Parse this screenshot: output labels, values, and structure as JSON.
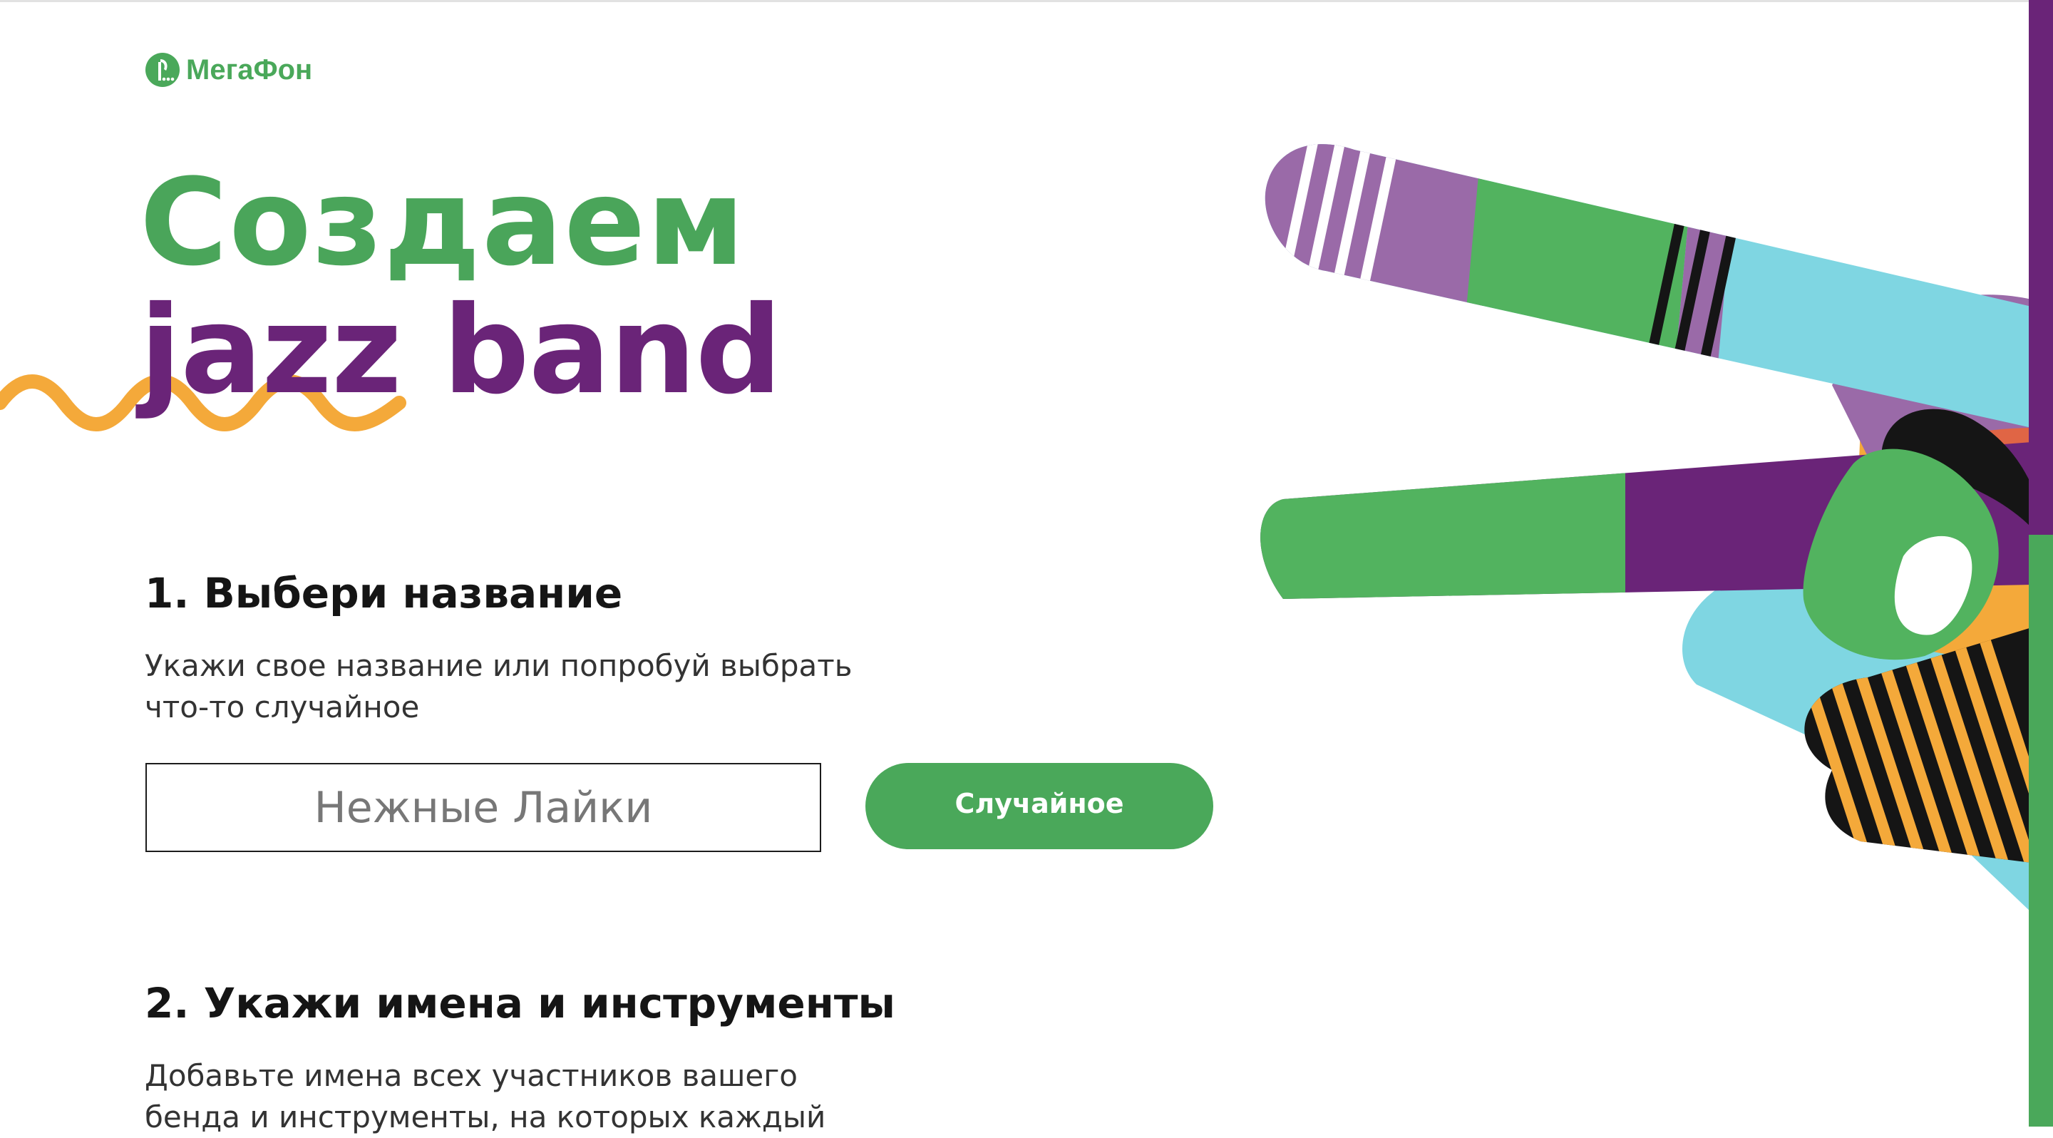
{
  "brand": {
    "name": "МегаФон",
    "colors": {
      "green": "#4aa85a",
      "purple": "#6a2478",
      "orange": "#f4a93a",
      "light_blue": "#7fd6e2",
      "lavender": "#9a6aa8"
    }
  },
  "hero": {
    "line1": "Создаем",
    "line2": "jazz band"
  },
  "step1": {
    "title": "1. Выбери название",
    "description": "Укажи свое название или попробуй выбрать что-то случайное",
    "input_placeholder": "Нежные Лайки",
    "random_button": "Случайное"
  },
  "step2": {
    "title": "2. Укажи имена и инструменты",
    "description": "Добавьте имена всех участников вашего бенда и инструменты, на которых каждый"
  },
  "icons": {
    "logo": "megafon-logo-icon",
    "illustration": "peace-hand-illustration",
    "squiggle": "wavy-line-decoration"
  }
}
